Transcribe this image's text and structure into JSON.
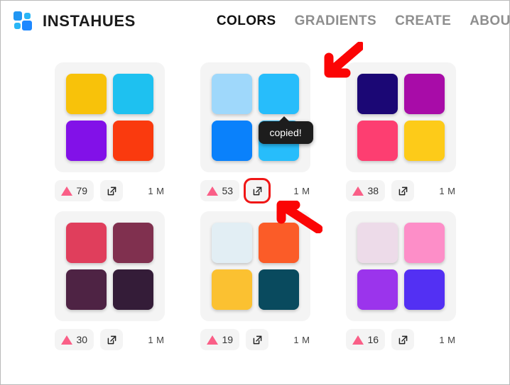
{
  "header": {
    "logo_icon": "instahues-logo-icon",
    "brand": "INSTAHUES",
    "nav": [
      {
        "label": "COLORS",
        "active": true
      },
      {
        "label": "GRADIENTS",
        "active": false
      },
      {
        "label": "CREATE",
        "active": false
      },
      {
        "label": "ABOUT",
        "active": false
      }
    ]
  },
  "tooltip": {
    "text": "copied!"
  },
  "icons": {
    "like": "triangle-up-icon",
    "share": "external-link-icon"
  },
  "colors": {
    "accent_like": "#fa5f87",
    "highlight_outline": "#f01616",
    "annotation_arrow": "#fb0505",
    "card_bg": "#f4f4f4",
    "tooltip_bg": "#1d1d1d"
  },
  "palettes": [
    {
      "id": "palette-1",
      "swatches": [
        "#f8c20a",
        "#1ec1f0",
        "#8211e8",
        "#fa3a0e"
      ],
      "likes": "79",
      "views": "1 M",
      "share_highlighted": false,
      "tooltip_visible": false
    },
    {
      "id": "palette-2",
      "swatches": [
        "#9fd8fb",
        "#27bdfb",
        "#0a81fb",
        "#27bdfb"
      ],
      "likes": "53",
      "views": "1 M",
      "share_highlighted": true,
      "tooltip_visible": true
    },
    {
      "id": "palette-3",
      "swatches": [
        "#1b0775",
        "#a80ca8",
        "#fd3e71",
        "#fdcb19"
      ],
      "likes": "38",
      "views": "1 M",
      "share_highlighted": false,
      "tooltip_visible": false
    },
    {
      "id": "palette-4",
      "swatches": [
        "#e03e5c",
        "#80304f",
        "#4e2344",
        "#341c38"
      ],
      "likes": "30",
      "views": "1 M",
      "share_highlighted": false,
      "tooltip_visible": false
    },
    {
      "id": "palette-5",
      "swatches": [
        "#e2eef4",
        "#fb5c28",
        "#fbc131",
        "#094a5e"
      ],
      "likes": "19",
      "views": "1 M",
      "share_highlighted": false,
      "tooltip_visible": false
    },
    {
      "id": "palette-6",
      "swatches": [
        "#eddbe9",
        "#fd8ec8",
        "#9b34ec",
        "#5330f3"
      ],
      "likes": "16",
      "views": "1 M",
      "share_highlighted": false,
      "tooltip_visible": false
    }
  ],
  "annotations": [
    {
      "name": "arrow-to-top-right-swatch",
      "direction": "down-left"
    },
    {
      "name": "arrow-to-share-button",
      "direction": "up-left"
    }
  ]
}
